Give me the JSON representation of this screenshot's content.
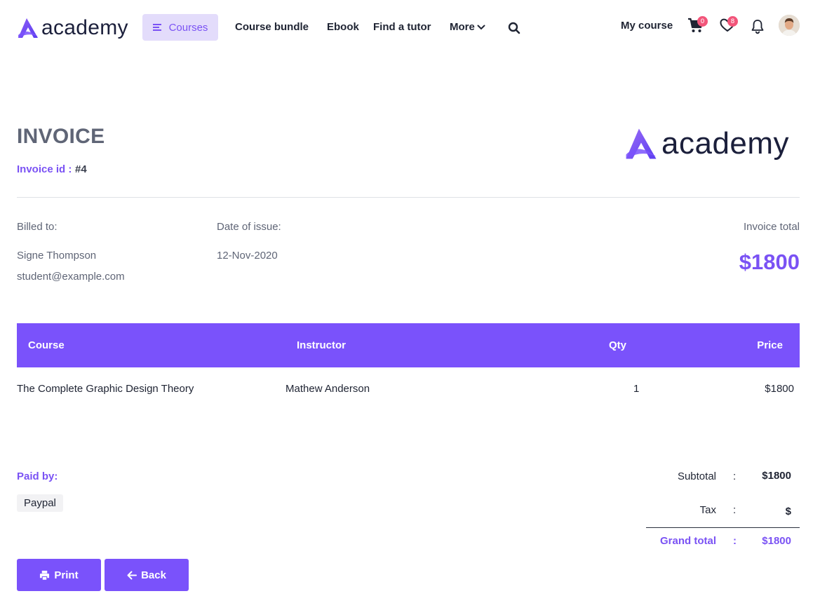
{
  "brand": {
    "name": "academy",
    "accent": "#7a52fb",
    "badge_color": "#f2557a"
  },
  "nav": {
    "courses": "Courses",
    "course_bundle": "Course bundle",
    "ebook": "Ebook",
    "find_tutor": "Find a tutor",
    "more": "More",
    "my_course": "My course",
    "cart_count": "0",
    "wishlist_count": "8",
    "icons": [
      "menu-icon",
      "chevron-down-icon",
      "search-icon",
      "cart-icon",
      "heart-icon",
      "bell-icon",
      "avatar"
    ]
  },
  "invoice": {
    "title": "INVOICE",
    "id_label": "Invoice id :",
    "id_value": "#4",
    "billed_to_label": "Billed to:",
    "billed_name": "Signe Thompson",
    "billed_email": "student@example.com",
    "date_label": "Date of issue:",
    "date_value": "12-Nov-2020",
    "total_label": "Invoice total",
    "total_value": "$1800"
  },
  "table": {
    "headers": {
      "course": "Course",
      "instructor": "Instructor",
      "qty": "Qty",
      "price": "Price"
    },
    "rows": [
      {
        "course": "The Complete Graphic Design Theory",
        "instructor": "Mathew Anderson",
        "qty": "1",
        "price": "$1800"
      }
    ]
  },
  "payment": {
    "paid_by_label": "Paid by:",
    "method": "Paypal"
  },
  "summary": {
    "subtotal_label": "Subtotal",
    "subtotal_value": "$1800",
    "tax_label": "Tax",
    "tax_value": "$",
    "grand_label": "Grand total",
    "grand_value": "$1800",
    "separator": ":"
  },
  "actions": {
    "print": "Print",
    "back": "Back"
  }
}
